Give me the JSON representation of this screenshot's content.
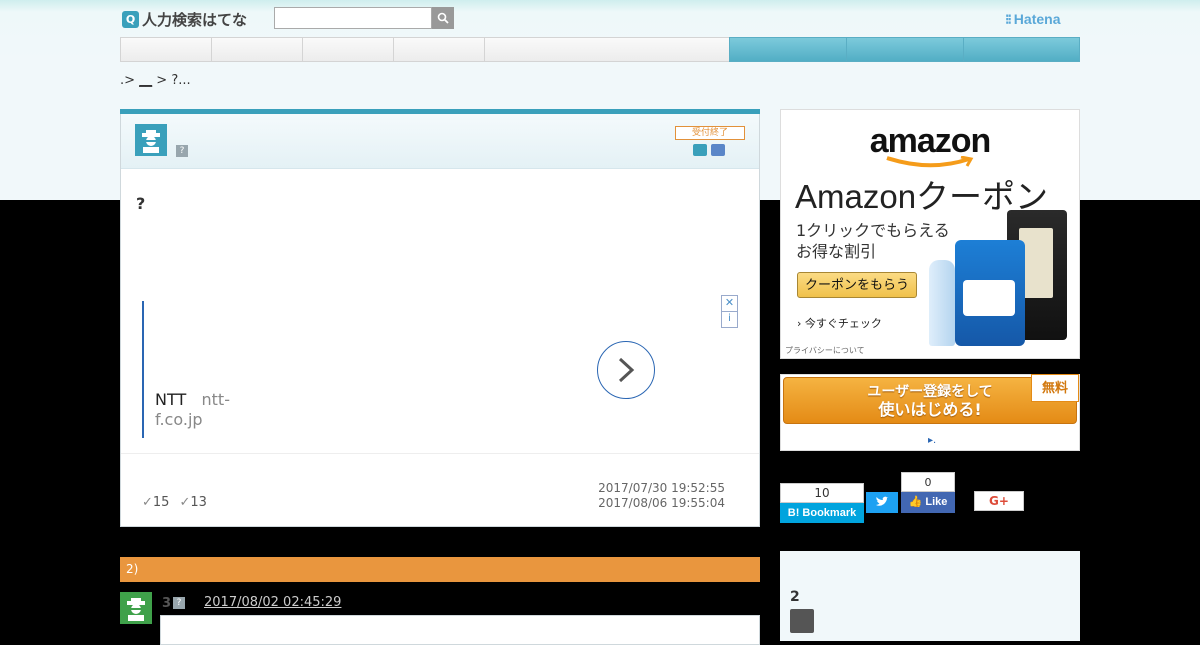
{
  "header": {
    "logo_text": "人力検索はてな",
    "logo_q": "Q",
    "search_placeholder": "",
    "brand": "Hatena"
  },
  "nav": {
    "items": [
      "",
      "",
      "",
      "",
      "",
      "",
      "",
      ""
    ]
  },
  "breadcrumb": {
    "start": ".> ",
    "link": "__",
    "rest": " > ?..."
  },
  "question": {
    "status": "受付終了",
    "help_mark": "?",
    "title": "?",
    "ad": {
      "brand": "NTT",
      "domain": "ntt-f.co.jp",
      "close": "✕",
      "info": "i"
    },
    "count_a": "15",
    "count_b": "13",
    "date_posted": "2017/07/30 19:52:55",
    "date_closed": "2017/08/06 19:55:04"
  },
  "answers": {
    "header": "2)",
    "first": {
      "number": "3",
      "help_mark": "?",
      "date": "2017/08/02 02:45:29"
    }
  },
  "amazon_ad": {
    "logo": "amazon",
    "title": "Amazonクーポン",
    "sub1": "1クリックでもらえる",
    "sub2": "お得な割引",
    "button": "クーポンをもらう",
    "check": "今すぐチェック",
    "privacy": "プライバシーについて"
  },
  "register": {
    "line1": "ユーザー登録をして",
    "line2": "使いはじめる!",
    "free": "無料",
    "link": "."
  },
  "social": {
    "bookmark_count": "10",
    "bookmark_label": "B! Bookmark",
    "tweet_label": "t",
    "fb_count": "0",
    "fb_label": "Like",
    "gplus_label": "G+"
  },
  "sidebar": {
    "section_title": "2"
  },
  "colors": {
    "teal": "#3aa0bb",
    "orange": "#e9963e",
    "green": "#3fa14a"
  }
}
